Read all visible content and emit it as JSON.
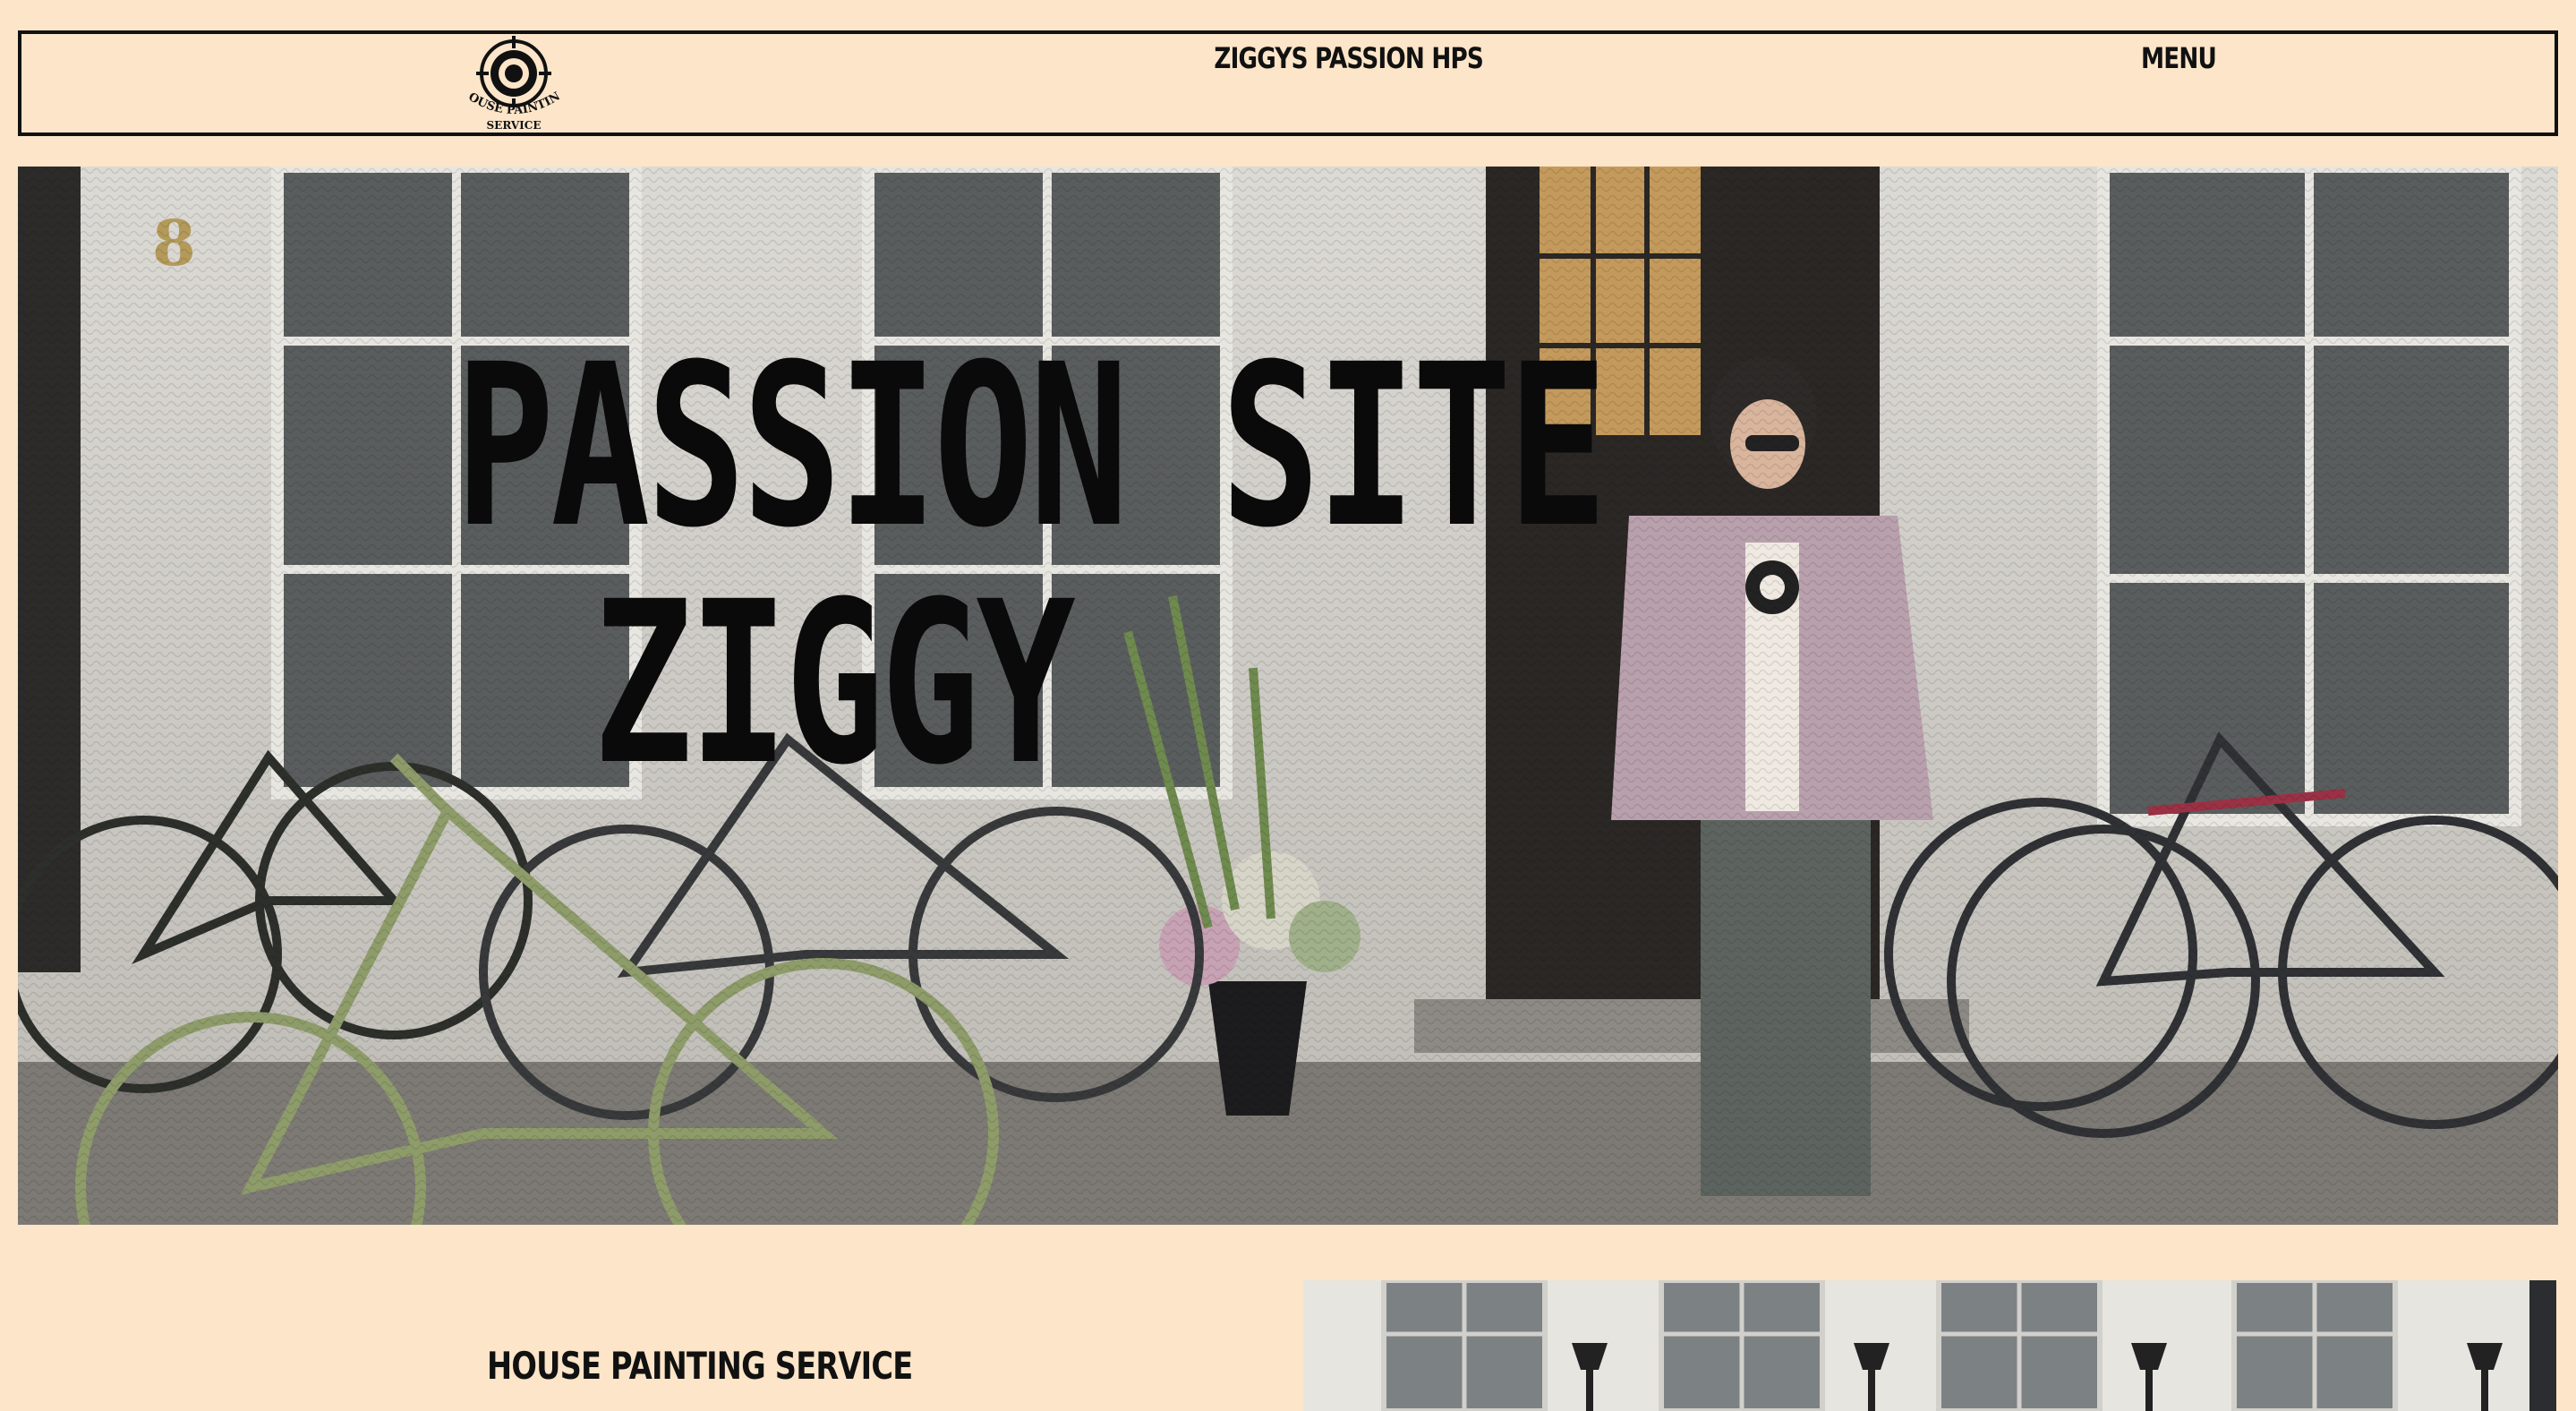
{
  "header": {
    "logo": {
      "text_line_1": "HOUSE PAINTING",
      "text_line_2": "SERVICE",
      "icon": "target-icon"
    },
    "title": "ZIGGYS PASSION HPS",
    "menu_label": "MENU"
  },
  "hero": {
    "line_1": "PASSION SITE",
    "line_2": "ZIGGY",
    "image_icon": "photo-storefront-with-bicycles",
    "house_number": "8"
  },
  "section": {
    "heading": "HOUSE PAINTING SERVICE",
    "image_icon": "photo-building-facade"
  },
  "colors": {
    "background": "#fce5c8",
    "ink": "#111111"
  }
}
